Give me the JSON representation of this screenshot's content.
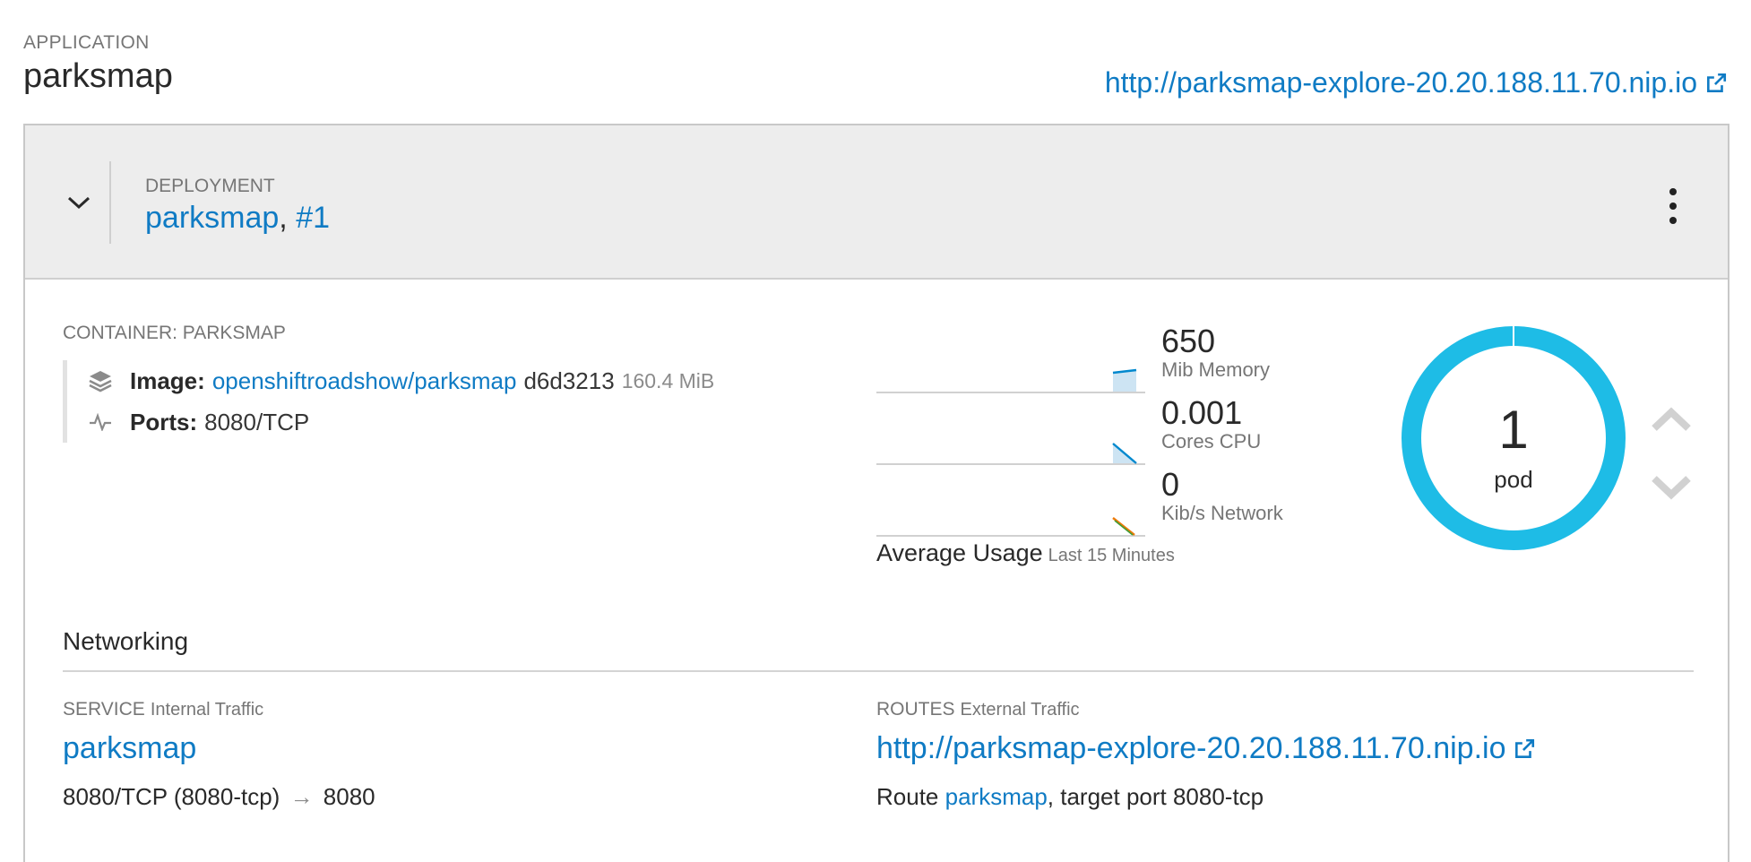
{
  "app": {
    "kicker": "APPLICATION",
    "name": "parksmap",
    "url": "http://parksmap-explore-20.20.188.11.70.nip.io"
  },
  "deployment": {
    "kicker": "DEPLOYMENT",
    "name": "parksmap",
    "separator": ",",
    "revision": "#1"
  },
  "container": {
    "kicker": "CONTAINER: PARKSMAP",
    "image_label": "Image:",
    "image_name": "openshiftroadshow/parksmap",
    "image_sha": "d6d3213",
    "image_size": "160.4 MiB",
    "ports_label": "Ports:",
    "ports_value": "8080/TCP"
  },
  "metrics": [
    {
      "value": "650",
      "label": "Mib Memory"
    },
    {
      "value": "0.001",
      "label": "Cores CPU"
    },
    {
      "value": "0",
      "label": "Kib/s Network"
    }
  ],
  "average_usage": {
    "label": "Average Usage",
    "range": "Last 15 Minutes"
  },
  "pods": {
    "count": "1",
    "label": "pod"
  },
  "networking": {
    "title": "Networking",
    "service": {
      "kicker": "SERVICE",
      "kicker_sub": "Internal Traffic",
      "name": "parksmap",
      "ports_from": "8080/TCP (8080-tcp)",
      "arrow": "→",
      "ports_to": "8080"
    },
    "routes": {
      "kicker": "ROUTES",
      "kicker_sub": "External Traffic",
      "url": "http://parksmap-explore-20.20.188.11.70.nip.io",
      "prefix": "Route",
      "route_name": "parksmap",
      "suffix": ", target port 8080-tcp"
    }
  },
  "colors": {
    "link": "#0f7bc4",
    "donut": "#1ebce6",
    "header_bg": "#ededed",
    "memory_spark": "#0088ce",
    "network_spark_a": "#ec7a08",
    "network_spark_b": "#3f9c35"
  },
  "icons": [
    "external-link-icon",
    "chevron-down-icon",
    "kebab-menu-icon",
    "layers-icon",
    "activity-icon",
    "chevron-up-icon"
  ]
}
